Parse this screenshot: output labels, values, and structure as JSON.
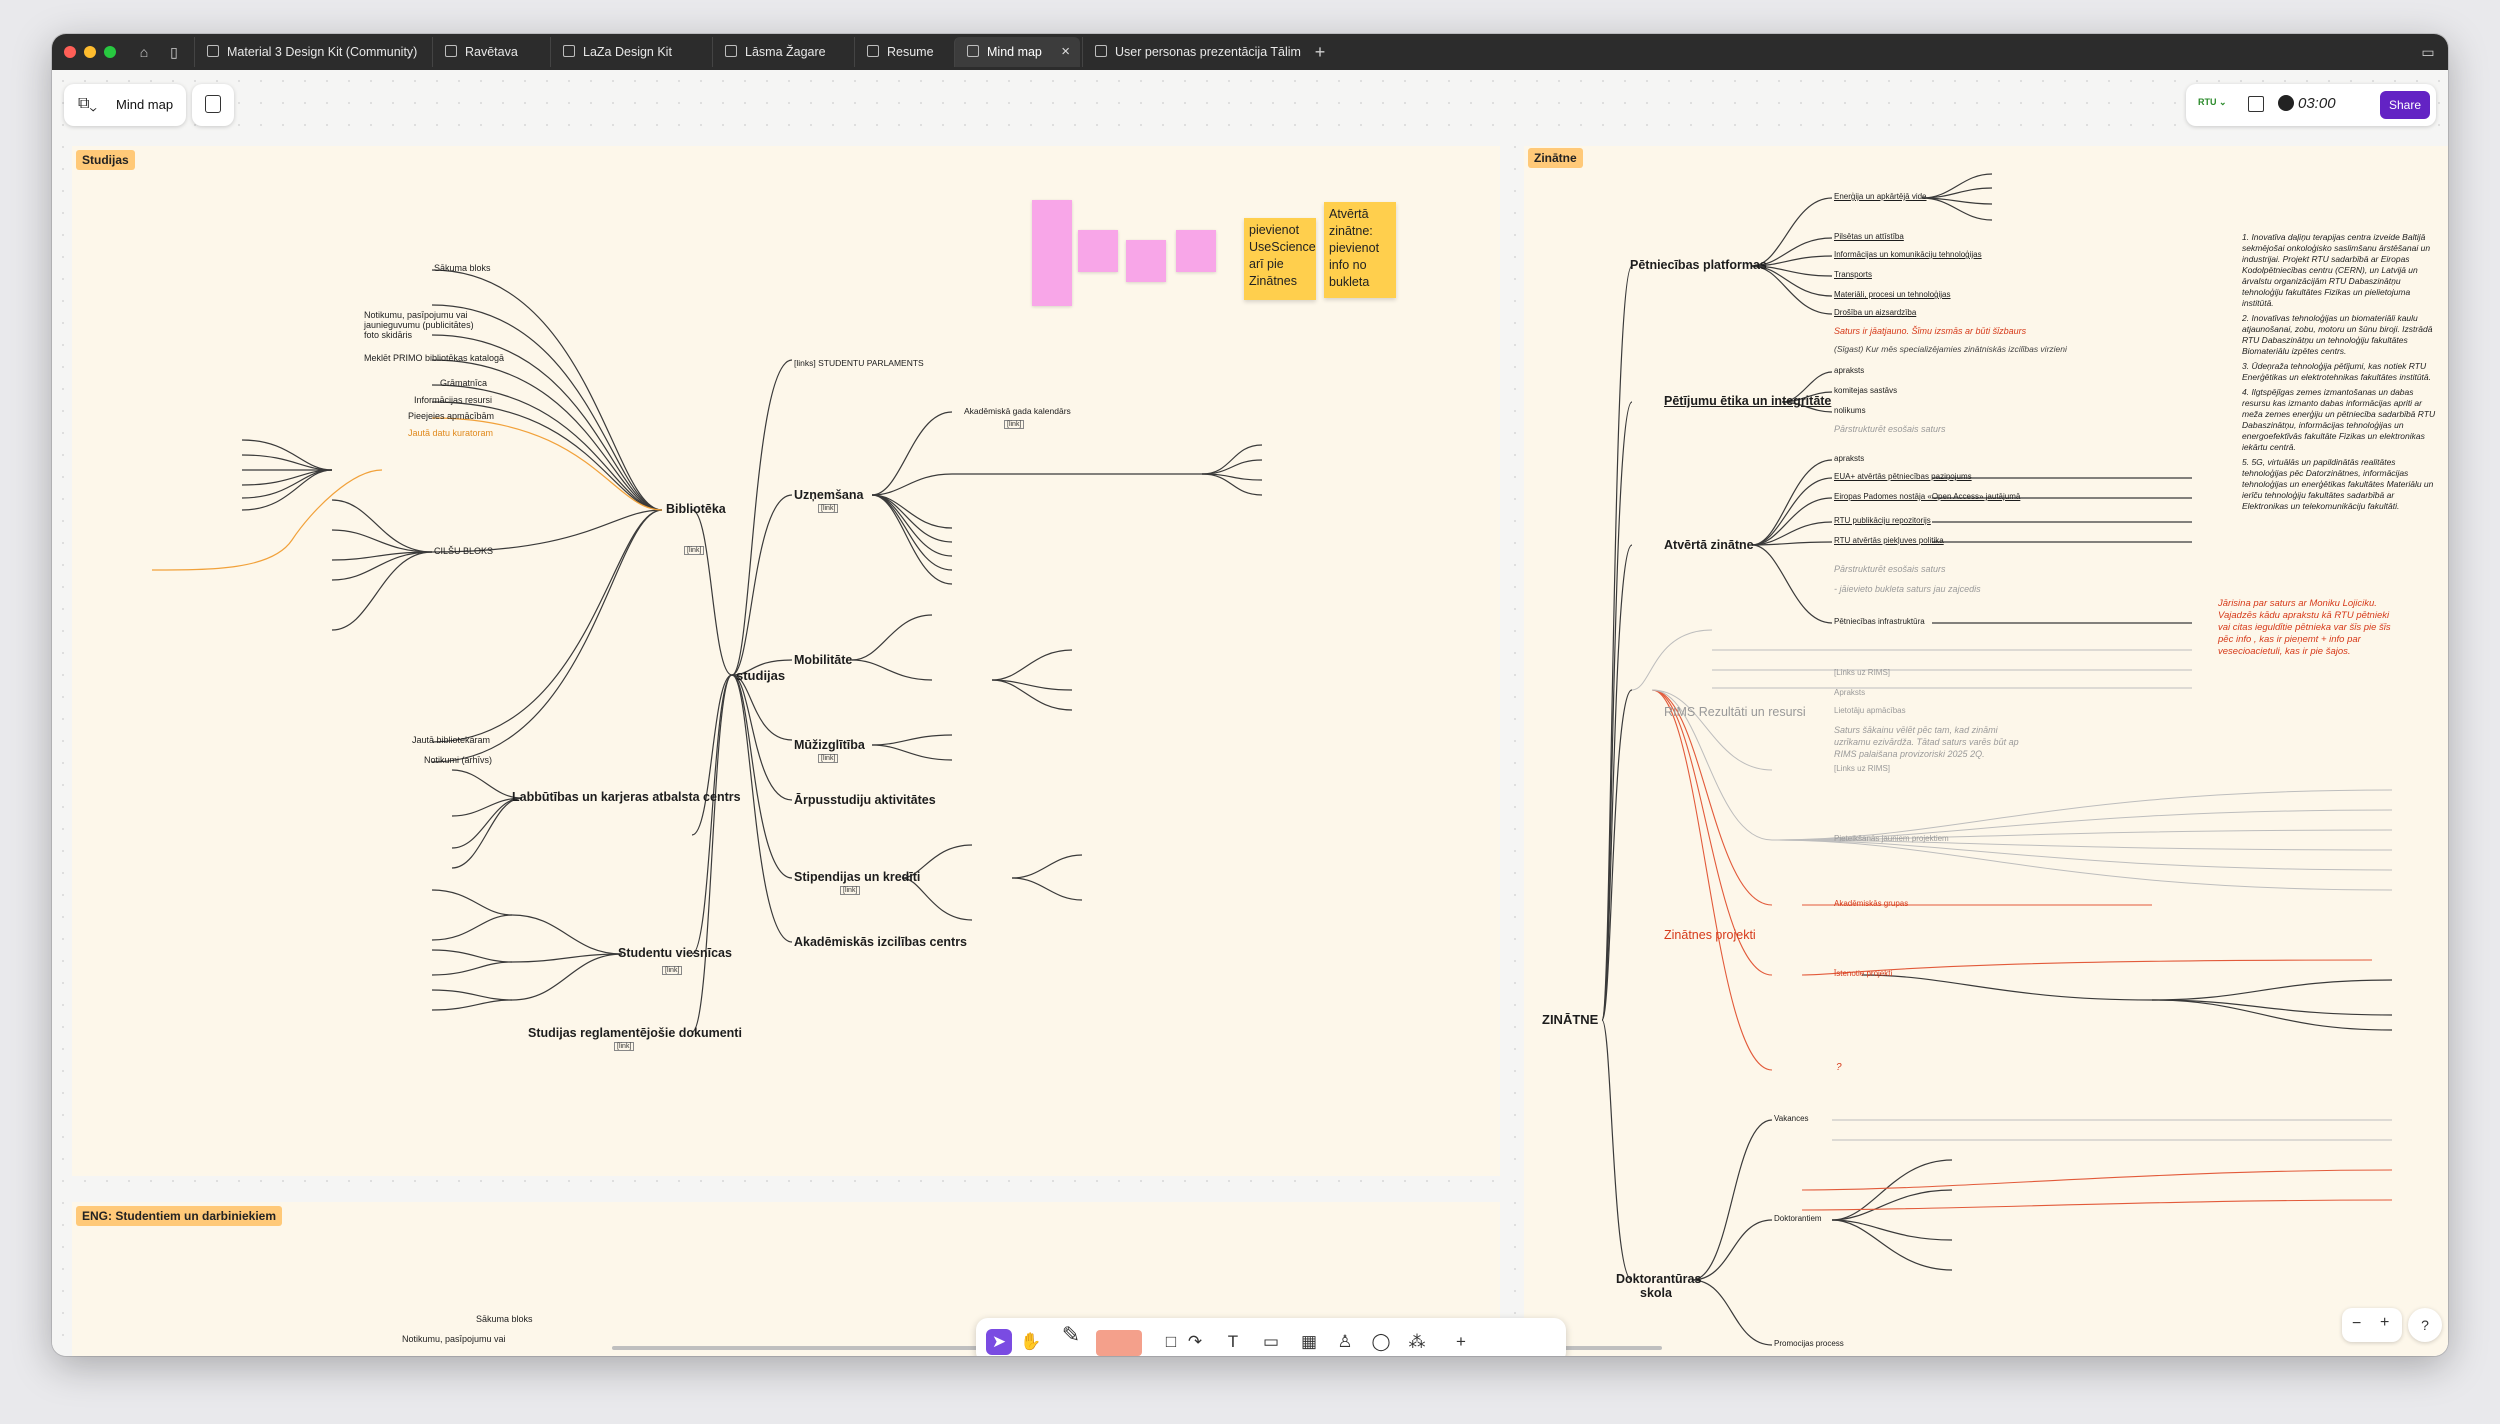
{
  "tabs": [
    {
      "label": "Material 3 Design Kit (Community)"
    },
    {
      "label": "Ravētava"
    },
    {
      "label": "LaZa Design Kit"
    },
    {
      "label": "Lāsma Žagare"
    },
    {
      "label": "Resume"
    },
    {
      "label": "Mind map",
      "close": "×"
    },
    {
      "label": "User personas prezentācija Tālim"
    }
  ],
  "new_tab": "+",
  "file": {
    "name": "Mind map"
  },
  "header": {
    "team": "RTU",
    "timer": "03:00",
    "share": "Share"
  },
  "sections": {
    "studijas": "Studijas",
    "zinatne": "Zinātne",
    "eng": "ENG: Studentiem un darbiniekiem"
  },
  "stickies": {
    "s1": "pievienot\nUseScience\narī pie\nZinātnes",
    "s2": "Atvērtā\nzinātne:\npievienot\ninfo no\nbukleta"
  },
  "studijas": {
    "root": "studijas",
    "link": "[link]",
    "biblioteka": "Bibliotēka",
    "bib_children": [
      "Sākuma bloks",
      "Notikumu, pasīpojumu vai jaunieguvumu (publicitātes) foto skidāris",
      "Meklēt PRIMO bibliotēkas katalogā",
      "Grāmatnīca",
      "Informācijas resursi",
      "Pieejeies apmācībām",
      "Jautā datu kuratoram",
      "CILŠU BLOKS",
      "Jautā bibliotekāram",
      "Notikumi (arhīvs)"
    ],
    "labbutibas": "Labbūtības un karjeras atbalsta centrs",
    "studentu_viesnicas": "Studentu viesnīcas",
    "reglamentejosie": "Studijas reglamentējošie dokumenti",
    "studentu_parlaments": "[links] STUDENTU PARLAMENTS",
    "uznemsana": "Uzņemšana",
    "akademiska_gada": "Akadēmiskā gada kalendārs",
    "mobilitate": "Mobilitāte",
    "muzizglitiba": "Mūžizglītība",
    "arpusstudiju": "Ārpusstudiju aktivitātes",
    "stipendijas": "Stipendijas un kredīti",
    "akademiskas_izcilibas": "Akadēmiskās izcilības centrs",
    "eng_sakuma": "Sākuma bloks",
    "eng_notikumu": "Notikumu, pasīpojumu vai"
  },
  "zinatne": {
    "root": "ZINĀTNE",
    "petniecibas_platformas": "Pētniecības platformas",
    "pp_children": [
      "Enerģija un apkārtējā vide",
      "Pilsētas un attīstība",
      "Informācijas un komunikāciju tehnoloģijas",
      "Transports",
      "Materiāli, procesi un tehnoloģijas",
      "Drošība un aizsardzība"
    ],
    "pp_red": "Saturs ir jāatjauno. Šīmu izsmās ar būti šīzbaurs",
    "pp_gray": "(Sīgast) Kur mēs specializējamies zinātniskās izcilības virzieni",
    "etika": "Pētījumu ētika un integritāte",
    "etika_children": [
      "apraksts",
      "komitejas sastāvs",
      "nolikums"
    ],
    "etika_gray": "Pārstrukturēt esošais saturs",
    "atverta": "Atvērtā zinātne",
    "atverta_children": [
      "apraksts",
      "EUA+ atvērtās pētniecības paziņojums",
      "Eiropas Padomes nostāja «Open Access» jautājumā",
      "RTU publikāciju repozitorijs",
      "RTU atvērtās piekļuves politika"
    ],
    "atverta_gray1": "Pārstrukturēt esošais saturs",
    "atverta_gray2": "- jāievieto bukleta saturs jau zajcedis",
    "infrastruktura": "Pētniecības infrastruktūra",
    "infra_red": "Jārisina par saturs ar Moniku Lojiciku.\nVajadzēs kādu aprakstu kā RTU pētnieki\nvai citas ieguldītie pētnieka var šīs pie šīs\npēc info , kas ir pieņemt + info par\nvesecioacietuli, kas ir pie šajos.",
    "rims": "RIMS Rezultāti un resursi",
    "rims_children": [
      "[Links uz RIMS]",
      "Apraksts",
      "Lietotāju apmācības"
    ],
    "rims_gray": "Saturs šākainu vēlēt pēc tam, kad zināmi\nuzrīkamu ezivārdža. Tātad saturs varēs būt ap\nRIMS palaišana provizoriski 2025 2Q.",
    "projekti": "Zinātnes projekti",
    "proj_children": [
      "[Links uz RIMS]",
      "Pieteikšanās jauniem projektiem",
      "Akadēmiskās grupas",
      "Īstenotie projekti"
    ],
    "proj_red": "?",
    "doktorantura": "Doktorantūras skola",
    "dok_children": [
      "Vakances",
      "Doktorantiem",
      "Promocijas process"
    ],
    "right_list": [
      "1. Inovatīva daļiņu terapijas centra izveide Baltijā sekmējošai onkoloģisko saslimšanu ārstēšanai un industrijai. Projekt RTU sadarbībā ar Eiropas Kodolpētniecības centru (CERN), un Latvijā un ārvalstu organizācijām RTU Dabaszinātņu tehnoloģiju fakultātes Fizikas un pielietojuma institūtā.",
      "2. Inovatīvas tehnoloģijas un biomateriāli kaulu atjaunošanai, zobu, motoru un šūnu biroji. Izstrādā RTU Dabaszinātņu un tehnoloģiju fakultātes Biomateriālu izpētes centrs.",
      "3. Ūdeņraža tehnoloģija pētījumi, kas notiek RTU Enerģētikas un elektrotehnikas fakultātes institūtā.",
      "4. Ilgtspējīgas zemes izmantošanas un dabas resursu kas izmanto dabas informācijas apriti ar meža zemes enerģiju un pētniecība sadarbībā RTU Dabaszinātņu, informācijas tehnoloģijas un energoefektīvās fakultāte Fizikas un elektronikas iekārtu centrā.",
      "5. 5G, virtuālās un papildinātās realitātes tehnoloģijas pēc Datorzinātnes, informācijas tehnoloģijas un enerģētikas fakultātes Materiālu un ierīču tehnoloģiju fakultātes sadarbībā ar Elektronikas un telekomunikāciju fakultāti."
    ]
  },
  "zoom": {
    "minus": "−",
    "plus": "+",
    "help": "?"
  }
}
